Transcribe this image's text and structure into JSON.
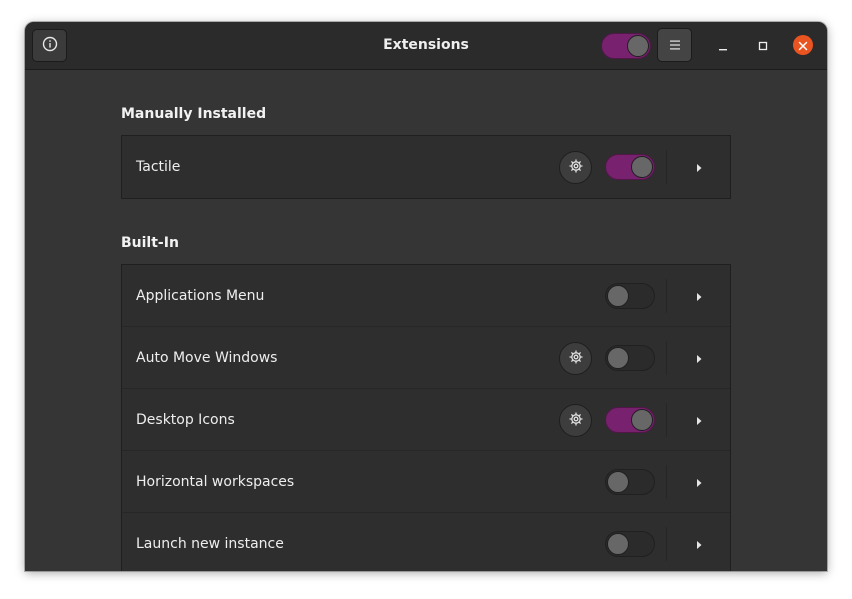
{
  "window": {
    "title": "Extensions",
    "global_switch_on": true
  },
  "header": {
    "info_icon": "info-icon",
    "menu_icon": "hamburger-menu-icon",
    "controls": [
      "minimize-icon",
      "maximize-icon",
      "close-icon"
    ]
  },
  "sections": {
    "manual": {
      "title": "Manually Installed",
      "items": [
        {
          "label": "Tactile",
          "has_settings": true,
          "enabled": true
        }
      ]
    },
    "builtin": {
      "title": "Built-In",
      "items": [
        {
          "label": "Applications Menu",
          "has_settings": false,
          "enabled": false
        },
        {
          "label": "Auto Move Windows",
          "has_settings": true,
          "enabled": false
        },
        {
          "label": "Desktop Icons",
          "has_settings": true,
          "enabled": true
        },
        {
          "label": "Horizontal workspaces",
          "has_settings": false,
          "enabled": false
        },
        {
          "label": "Launch new instance",
          "has_settings": false,
          "enabled": false
        }
      ]
    }
  },
  "colors": {
    "accent": "#77216f",
    "close": "#e95420",
    "window_bg": "#353535",
    "headerbar_bg": "#2b2b2b"
  }
}
